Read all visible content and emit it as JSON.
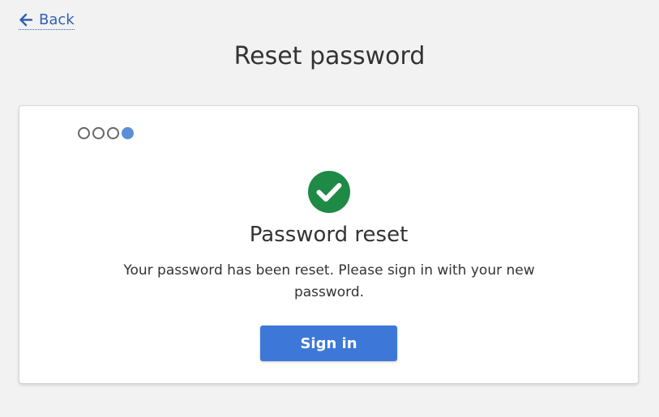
{
  "nav": {
    "back_label": "Back"
  },
  "header": {
    "title": "Reset password"
  },
  "progress": {
    "total_steps": 4,
    "current_step": 4
  },
  "confirmation": {
    "icon": "check-circle-icon",
    "title": "Password reset",
    "message": "Your password has been reset. Please sign in with your new password.",
    "button_label": "Sign in"
  },
  "colors": {
    "link": "#2f5fb3",
    "success": "#1e8a45",
    "primary_button": "#3d78d8",
    "active_step": "#5b8fd6",
    "page_background": "#f2f2f2"
  }
}
